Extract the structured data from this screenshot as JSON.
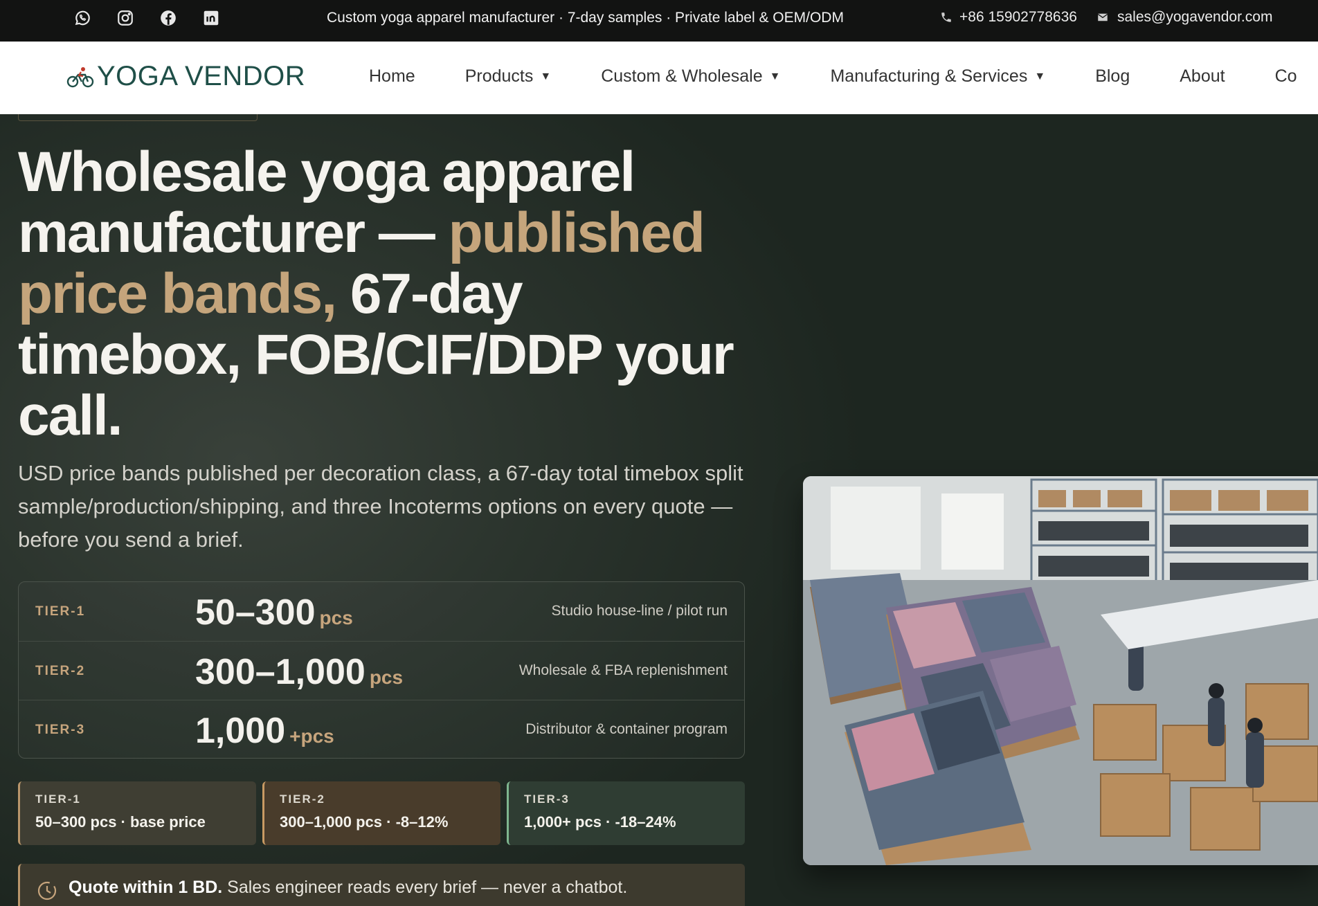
{
  "topbar": {
    "social": [
      "whatsapp-icon",
      "instagram-icon",
      "facebook-icon",
      "linkedin-icon"
    ],
    "announcement": "Custom yoga apparel manufacturer · 7-day samples · Private label & OEM/ODM",
    "phone": "+86 15902778636",
    "email": "sales@yogavendor.com"
  },
  "header": {
    "logo_text": "YOGA VENDOR",
    "nav": [
      "Home",
      "Products",
      "Custom & Wholesale",
      "Manufacturing & Services",
      "Blog",
      "About",
      "Co"
    ],
    "caret": "▼"
  },
  "hero": {
    "headline_part1": "Wholesale yoga apparel manufacturer — ",
    "headline_accent": "published price bands,",
    "headline_part2": " 67-day timebox, FOB/CIF/DDP your call.",
    "subtext": "USD price bands published per decoration class, a 67-day total timebox split sample/production/shipping, and three Incoterms options on every quote — before you send a brief.",
    "tiers": [
      {
        "label": "TIER-1",
        "qty": "50–300",
        "unit": "pcs",
        "desc": "Studio house-line / pilot run"
      },
      {
        "label": "TIER-2",
        "qty": "300–1,000",
        "unit": "pcs",
        "desc": "Wholesale & FBA replenishment"
      },
      {
        "label": "TIER-3",
        "qty": "1,000",
        "unit": "+pcs",
        "desc": "Distributor & container program"
      }
    ],
    "badges": [
      {
        "label": "TIER-1",
        "text": "50–300 pcs · base price"
      },
      {
        "label": "TIER-2",
        "text": "300–1,000 pcs · -8–12%"
      },
      {
        "label": "TIER-3",
        "text": "1,000+ pcs · -18–24%"
      }
    ],
    "note_bold": "Quote within 1 BD.",
    "note_text": " Sales engineer reads every brief — never a chatbot."
  },
  "colors": {
    "accent": "#c5a57c",
    "topbar_bg": "#121312",
    "hero_bg": "#2a332c",
    "logo": "#1f4f48"
  }
}
